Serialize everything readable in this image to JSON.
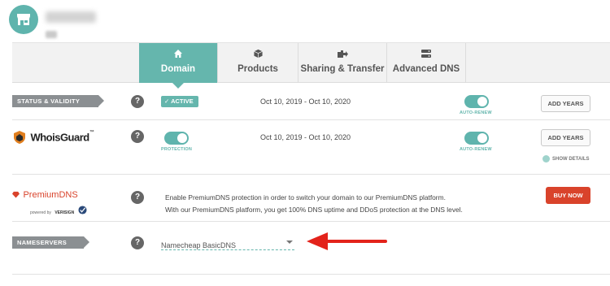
{
  "tabs": [
    {
      "label": "Domain",
      "icon": "home-icon",
      "active": true
    },
    {
      "label": "Products",
      "icon": "box-icon",
      "active": false
    },
    {
      "label": "Sharing & Transfer",
      "icon": "share-transfer-icon",
      "active": false
    },
    {
      "label": "Advanced DNS",
      "icon": "server-icon",
      "active": false
    }
  ],
  "status_row": {
    "label": "STATUS & VALIDITY",
    "badge": "✓ ACTIVE",
    "dates": "Oct 10, 2019 - Oct 10, 2020",
    "autorenew_label": "AUTO-RENEW",
    "autorenew_on": true,
    "button": "ADD YEARS"
  },
  "whoisguard_row": {
    "logo_text": "WhoisGuard",
    "logo_tm": "™",
    "protection_label": "PROTECTION",
    "dates": "Oct 10, 2019 - Oct 10, 2020",
    "autorenew_label": "AUTO-RENEW",
    "button": "ADD YEARS",
    "show_details": "SHOW DETAILS"
  },
  "premiumdns_row": {
    "logo_text": "PremiumDNS",
    "powered_by": "powered by",
    "powered_brand": "VERISIGN",
    "description_line1": "Enable PremiumDNS protection in order to switch your domain to our PremiumDNS platform.",
    "description_line2": "With our PremiumDNS platform, you get 100% DNS uptime and DDoS protection at the DNS level.",
    "button": "BUY NOW"
  },
  "nameservers_row": {
    "label": "NAMESERVERS",
    "selected": "Namecheap BasicDNS"
  },
  "help_symbol": "?",
  "colors": {
    "accent": "#65b6ad",
    "buy_button": "#d9432b",
    "arrow": "#e3231b",
    "label_tag": "#8b8f92"
  }
}
